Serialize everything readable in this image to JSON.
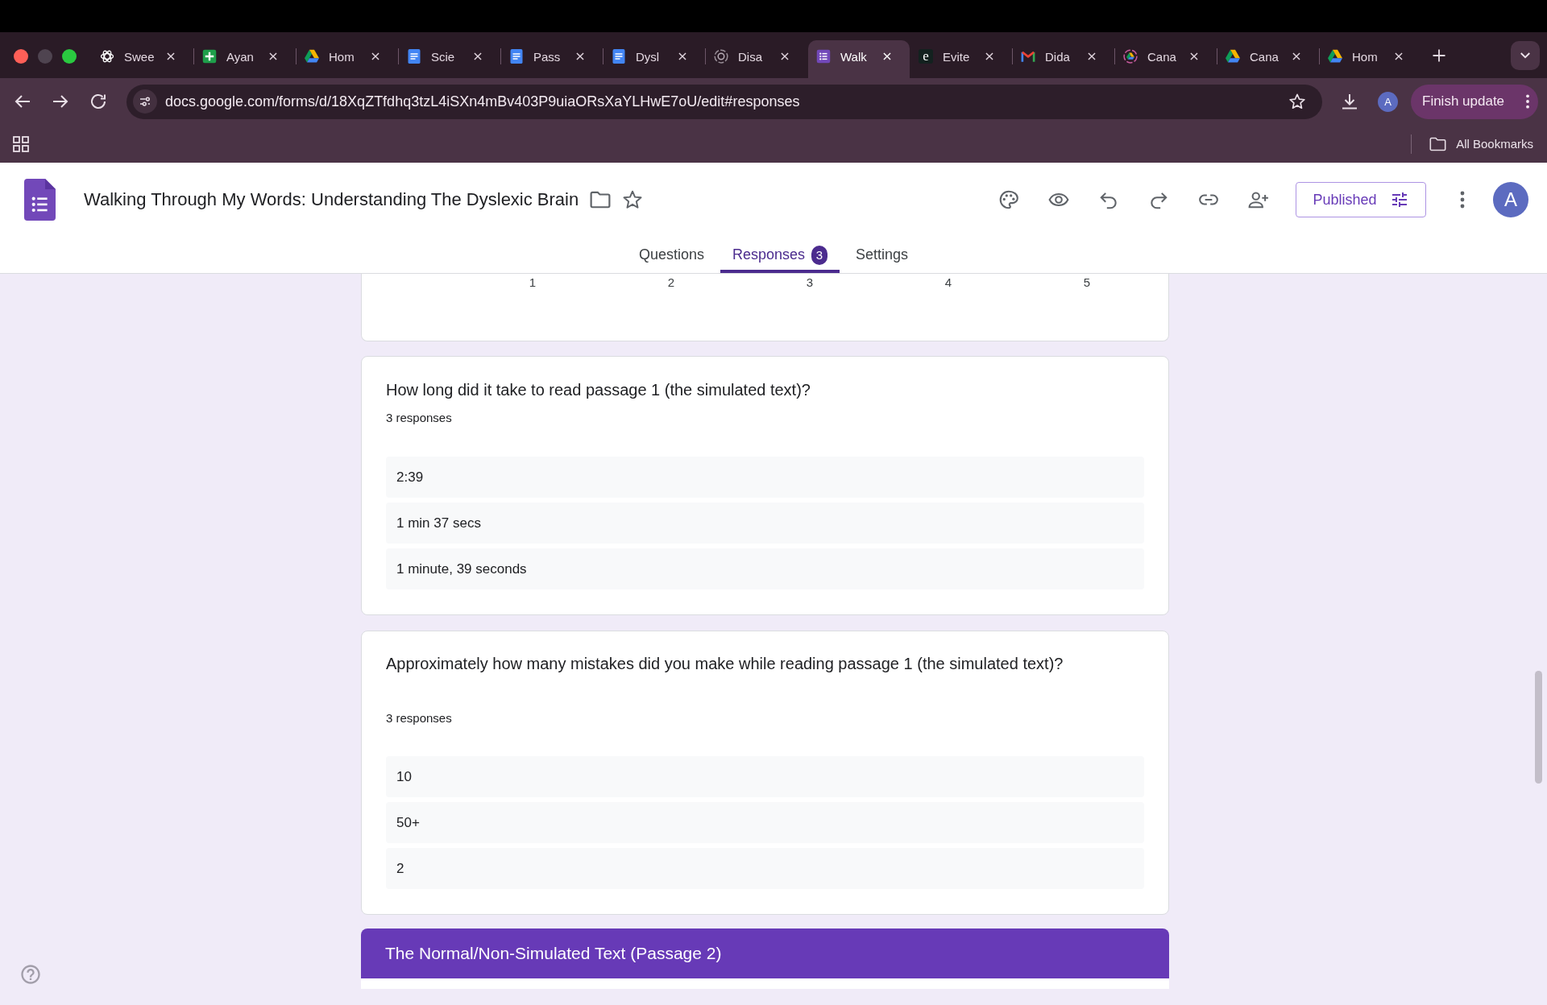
{
  "browser": {
    "tabs": [
      {
        "label": "Swee",
        "kind": "chat",
        "selected": false
      },
      {
        "label": "Ayan",
        "kind": "sheets",
        "selected": false
      },
      {
        "label": "Hom",
        "kind": "drive",
        "selected": false
      },
      {
        "label": "Scie",
        "kind": "docs",
        "selected": false
      },
      {
        "label": "Pass",
        "kind": "docs",
        "selected": false
      },
      {
        "label": "Dysl",
        "kind": "docs",
        "selected": false
      },
      {
        "label": "Disa",
        "kind": "ring",
        "selected": false
      },
      {
        "label": "Walk",
        "kind": "forms",
        "selected": true
      },
      {
        "label": "Evite",
        "kind": "letter",
        "icon_letter": "e",
        "selected": false
      },
      {
        "label": "Dida",
        "kind": "mail",
        "selected": false
      },
      {
        "label": "Cana",
        "kind": "ringed",
        "selected": false
      },
      {
        "label": "Cana",
        "kind": "drive",
        "selected": false
      },
      {
        "label": "Hom",
        "kind": "drive",
        "selected": false
      }
    ],
    "address": "docs.google.com/forms/d/18XqZTfdhq3tzL4iSXn4mBv403P9uiaORsXaYLHwE7oU/edit#responses",
    "profile_initial": "A",
    "update_button": "Finish update",
    "bookmarks_folder": "All Bookmarks"
  },
  "form": {
    "title": "Walking Through My Words: Understanding The Dyslexic Brain",
    "publish_button": "Published",
    "avatar_initial": "A",
    "tabs": [
      {
        "label": "Questions",
        "selected": false
      },
      {
        "label": "Responses",
        "selected": true,
        "count": "3"
      },
      {
        "label": "Settings",
        "selected": false
      }
    ]
  },
  "scale_card": {
    "labels": [
      "1",
      "2",
      "3",
      "4",
      "5"
    ]
  },
  "response_summaries": [
    {
      "question": "How long did it take to read passage 1 (the simulated text)?",
      "response_count": "3 responses",
      "answers": [
        "2:39",
        "1 min 37 secs",
        "1 minute, 39 seconds"
      ]
    },
    {
      "question": "Approximately how many mistakes did you make while reading passage 1 (the simulated text)?",
      "response_count": "3 responses",
      "answers": [
        "10",
        "50+",
        "2"
      ]
    }
  ],
  "section": {
    "title": "The Normal/Non-Simulated Text (Passage 2)"
  }
}
